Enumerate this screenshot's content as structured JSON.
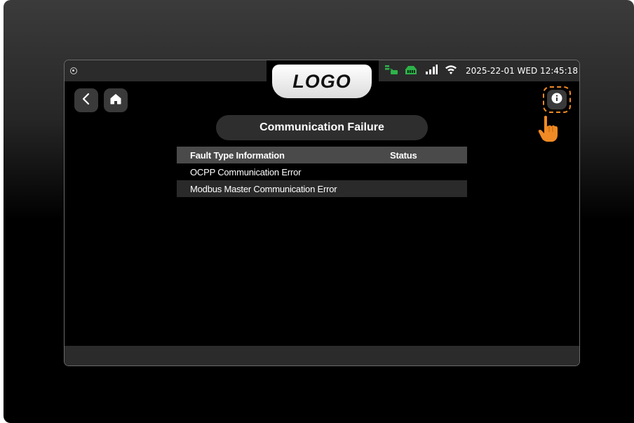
{
  "header": {
    "logo_text": "LOGO",
    "datetime": "2025-22-01 WED 12:45:18",
    "status_icons": [
      "charging-status-icon",
      "ethernet-icon",
      "cellular-signal-icon",
      "wifi-icon"
    ]
  },
  "nav": {
    "back_icon": "chevron-left-icon",
    "home_icon": "home-icon",
    "info_icon": "info-icon",
    "hint_icon": "tap-hand-icon"
  },
  "page": {
    "title": "Communication Failure"
  },
  "table": {
    "columns": [
      "Fault Type Information",
      "Status"
    ],
    "rows": [
      {
        "fault": "OCPP Communication Error",
        "status": ""
      },
      {
        "fault": "Modbus Master Communication Error",
        "status": ""
      }
    ]
  },
  "colors": {
    "accent_orange": "#f08a24",
    "status_green": "#2db34a",
    "panel_dark": "#2e2e2e"
  }
}
